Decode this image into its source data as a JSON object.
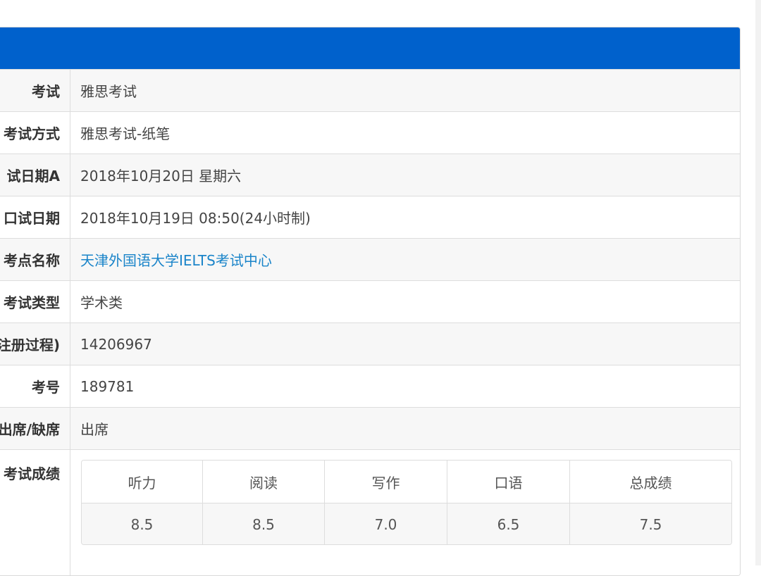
{
  "info_rows": [
    {
      "label": "考试",
      "value": "雅思考试"
    },
    {
      "label": "考试方式",
      "value": "雅思考试-纸笔"
    },
    {
      "label": "试日期A",
      "value": "2018年10月20日 星期六"
    },
    {
      "label": "口试日期",
      "value": "2018年10月19日 08:50(24小时制)"
    },
    {
      "label": "考点名称",
      "value": "天津外国语大学IELTS考试中心"
    },
    {
      "label": "考试类型",
      "value": "学术类"
    },
    {
      "label": "注册过程)",
      "value": "14206967"
    },
    {
      "label": "考号",
      "value": "189781"
    },
    {
      "label": "出席/缺席",
      "value": "出席"
    }
  ],
  "scores": {
    "label": "考试成绩",
    "headers": [
      "听力",
      "阅读",
      "写作",
      "口语",
      "总成绩"
    ],
    "values": [
      "8.5",
      "8.5",
      "7.0",
      "6.5",
      "7.5"
    ]
  },
  "colors": {
    "header": "#0061cc",
    "link": "#1a84c9"
  }
}
